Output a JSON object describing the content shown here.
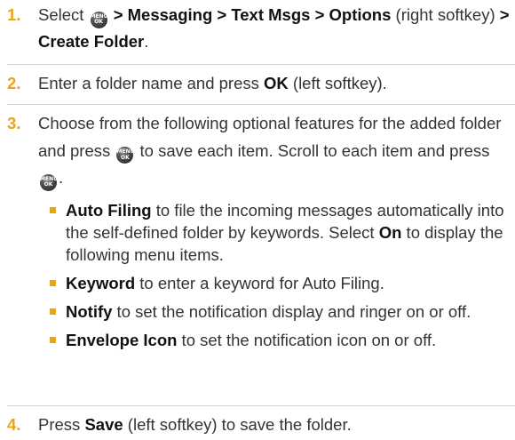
{
  "icons": {
    "menu_key": {
      "name": "menu-ok-key-icon",
      "line1": "MENU",
      "line2": "OK"
    }
  },
  "colors": {
    "step_number": "#e8a317",
    "bullet": "#e8a317",
    "text": "#333333",
    "divider": "#d2d2d2"
  },
  "steps": [
    {
      "number": "1.",
      "parts": [
        {
          "t": "Select "
        },
        {
          "icon": "menu_key"
        },
        {
          "b": " > Messaging > Text Msgs > Options"
        },
        {
          "t": " (right softkey) "
        },
        {
          "b": "> Create Folder"
        },
        {
          "t": "."
        }
      ]
    },
    {
      "number": "2.",
      "parts": [
        {
          "t": "Enter a folder name and press "
        },
        {
          "b": "OK"
        },
        {
          "t": " (left softkey)."
        }
      ]
    },
    {
      "number": "3.",
      "parts": [
        {
          "t": "Choose from the following optional features for the added folder and press "
        },
        {
          "icon": "menu_key"
        },
        {
          "t": " to save each item. Scroll to each item and press "
        },
        {
          "icon": "menu_key"
        },
        {
          "t": "."
        }
      ],
      "features": [
        {
          "term": "Auto Filing",
          "parts": [
            {
              "t": " to file the incoming messages automatically into the self-defined folder by keywords. Select "
            },
            {
              "b": "On"
            },
            {
              "t": " to display the following menu items."
            }
          ]
        },
        {
          "term": "Keyword",
          "parts": [
            {
              "t": " to enter a keyword for Auto Filing."
            }
          ]
        },
        {
          "term": "Notify",
          "parts": [
            {
              "t": " to set the notification display and ringer on or off."
            }
          ]
        },
        {
          "term": "Envelope Icon",
          "parts": [
            {
              "t": " to set the notification icon on or off."
            }
          ]
        }
      ]
    },
    {
      "number": "4.",
      "parts": [
        {
          "t": "Press "
        },
        {
          "b": "Save"
        },
        {
          "t": " (left softkey) to save the folder."
        }
      ]
    }
  ]
}
